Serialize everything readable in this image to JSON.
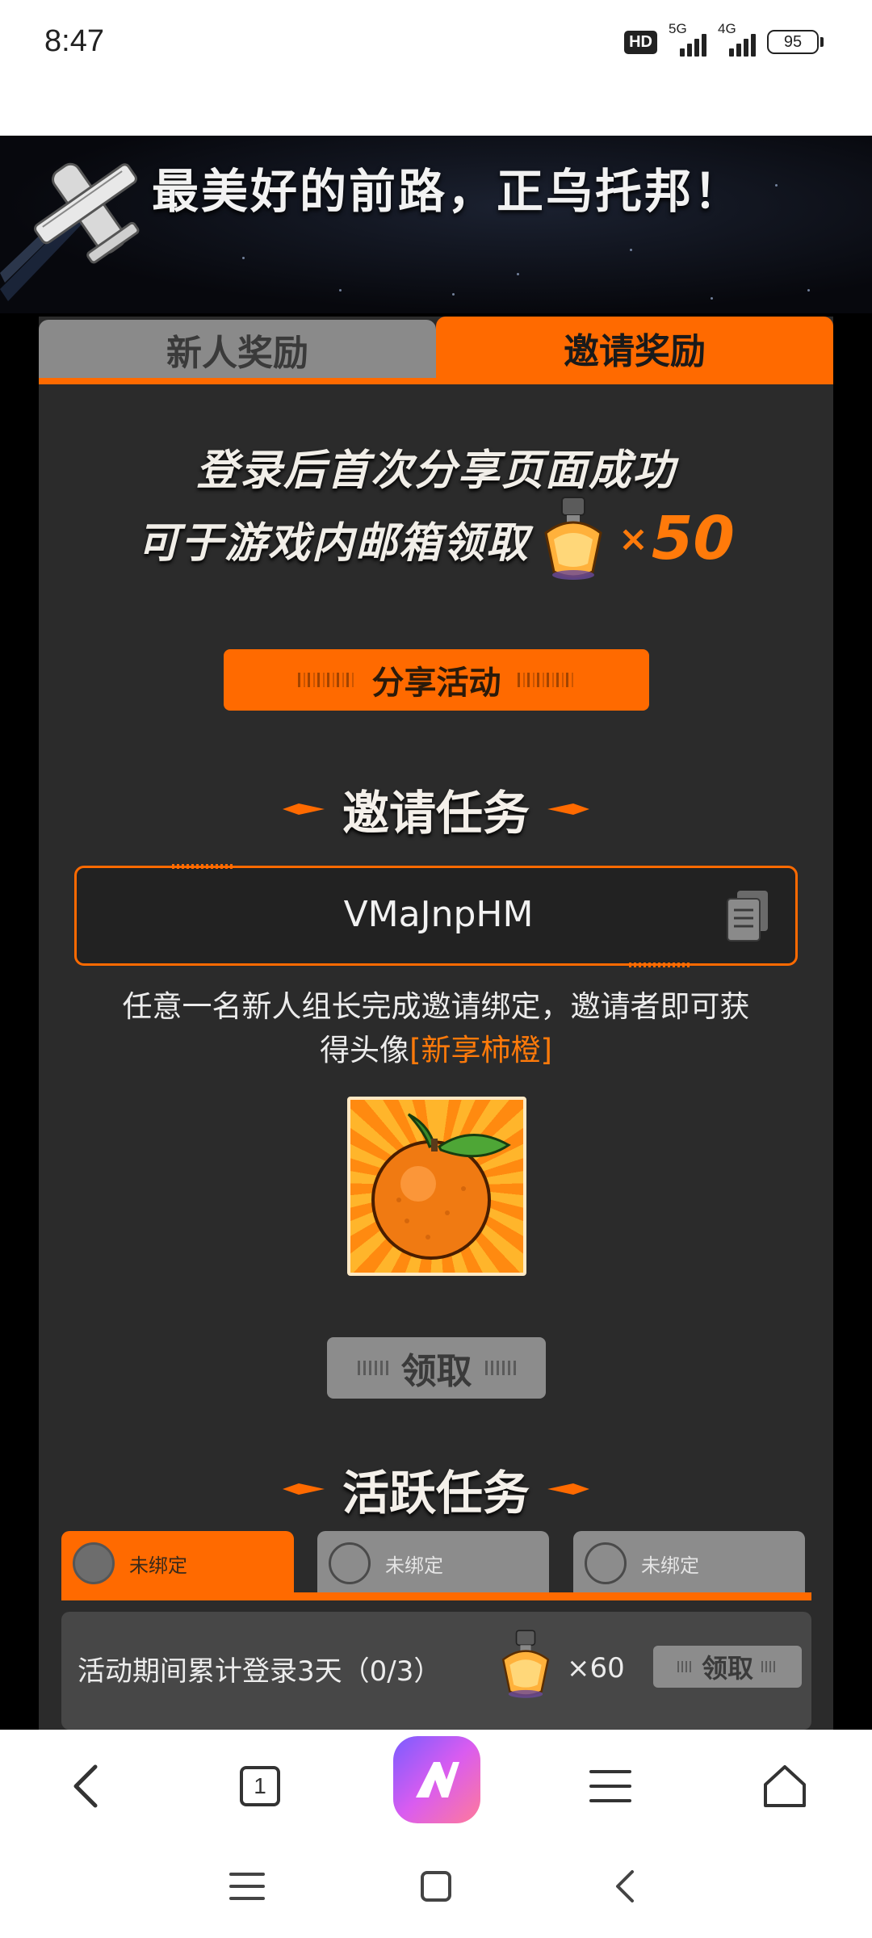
{
  "status_bar": {
    "time": "8:47",
    "hd_label": "HD",
    "network_1": "5G",
    "network_2": "4G",
    "battery_level": "95"
  },
  "banner": {
    "title": "最美好的前路，正乌托邦！"
  },
  "tabs": [
    {
      "label": "新人奖励",
      "active": false
    },
    {
      "label": "邀请奖励",
      "active": true
    }
  ],
  "share_section": {
    "line1": "登录后首次分享页面成功",
    "line2": "可于游戏内邮箱领取",
    "reward_x": "×",
    "reward_count": "50",
    "button_label": "分享活动"
  },
  "invite_section": {
    "title": "邀请任务",
    "invite_code": "VMaJnpHM",
    "desc_part1": "任意一名新人组长完成邀请绑定，邀请者即可获得头像",
    "desc_highlight": "[新享柿橙]",
    "claim_label": "领取"
  },
  "active_section": {
    "title": "活跃任务",
    "bind_slots": [
      {
        "label": "未绑定",
        "selected": true
      },
      {
        "label": "未绑定",
        "selected": false
      },
      {
        "label": "未绑定",
        "selected": false
      }
    ],
    "task": {
      "text": "活动期间累计登录3天（0/3）",
      "reward": "×60",
      "claim_label": "领取"
    }
  },
  "browser_bar": {
    "tab_count": "1"
  },
  "colors": {
    "accent": "#ff6a00",
    "panel": "#2b2b2b",
    "disabled": "#8c8c8c"
  },
  "icons": [
    "back-arrow-icon",
    "tabs-icon",
    "app-logo-icon",
    "menu-icon",
    "home-icon",
    "copy-icon",
    "perfume-bottle-icon",
    "orange-avatar-icon",
    "plane-icon"
  ]
}
